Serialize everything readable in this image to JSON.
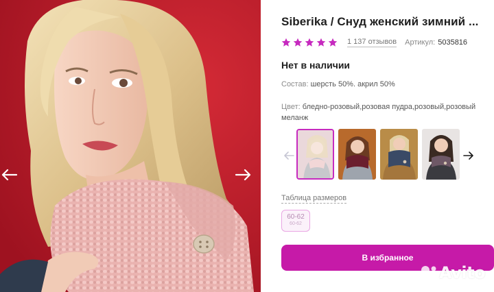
{
  "product": {
    "title": "Siberika / Снуд женский зимний ...",
    "reviews": "1 137 отзывов",
    "sku_label": "Артикул:",
    "sku_value": "5035816",
    "rating_stars": 5,
    "stock_status": "Нет в наличии",
    "composition_label": "Состав:",
    "composition_value": "шерсть 50%. акрил 50%",
    "color_label": "Цвет:",
    "color_value": "бледно-розовый,розовая пудра,розовый,розовый меланж"
  },
  "gallery": {
    "thumbnails": [
      {
        "name": "thumb-1",
        "selected": true,
        "scarf_color": "#c7c7c7"
      },
      {
        "name": "thumb-2",
        "selected": false,
        "scarf_color": "#6b1f2e"
      },
      {
        "name": "thumb-3",
        "selected": false,
        "scarf_color": "#3a4a66"
      },
      {
        "name": "thumb-4",
        "selected": false,
        "scarf_color": "#6e5866"
      }
    ]
  },
  "sizes": {
    "table_link": "Таблица размеров",
    "options": [
      {
        "main": "60-62",
        "sub": "60-62"
      }
    ]
  },
  "actions": {
    "favorite_label": "В избранное"
  },
  "watermark": {
    "text": "Avito"
  },
  "colors": {
    "accent": "#c61aa8",
    "star": "#c62abf",
    "background_red": "#c41e2e"
  },
  "icons": {
    "photo_prev": "arrow-left-icon",
    "photo_next": "arrow-right-icon",
    "thumb_prev": "arrow-left-icon",
    "thumb_next": "arrow-right-icon",
    "star": "star-icon",
    "watermark": "avito-logo-icon"
  }
}
